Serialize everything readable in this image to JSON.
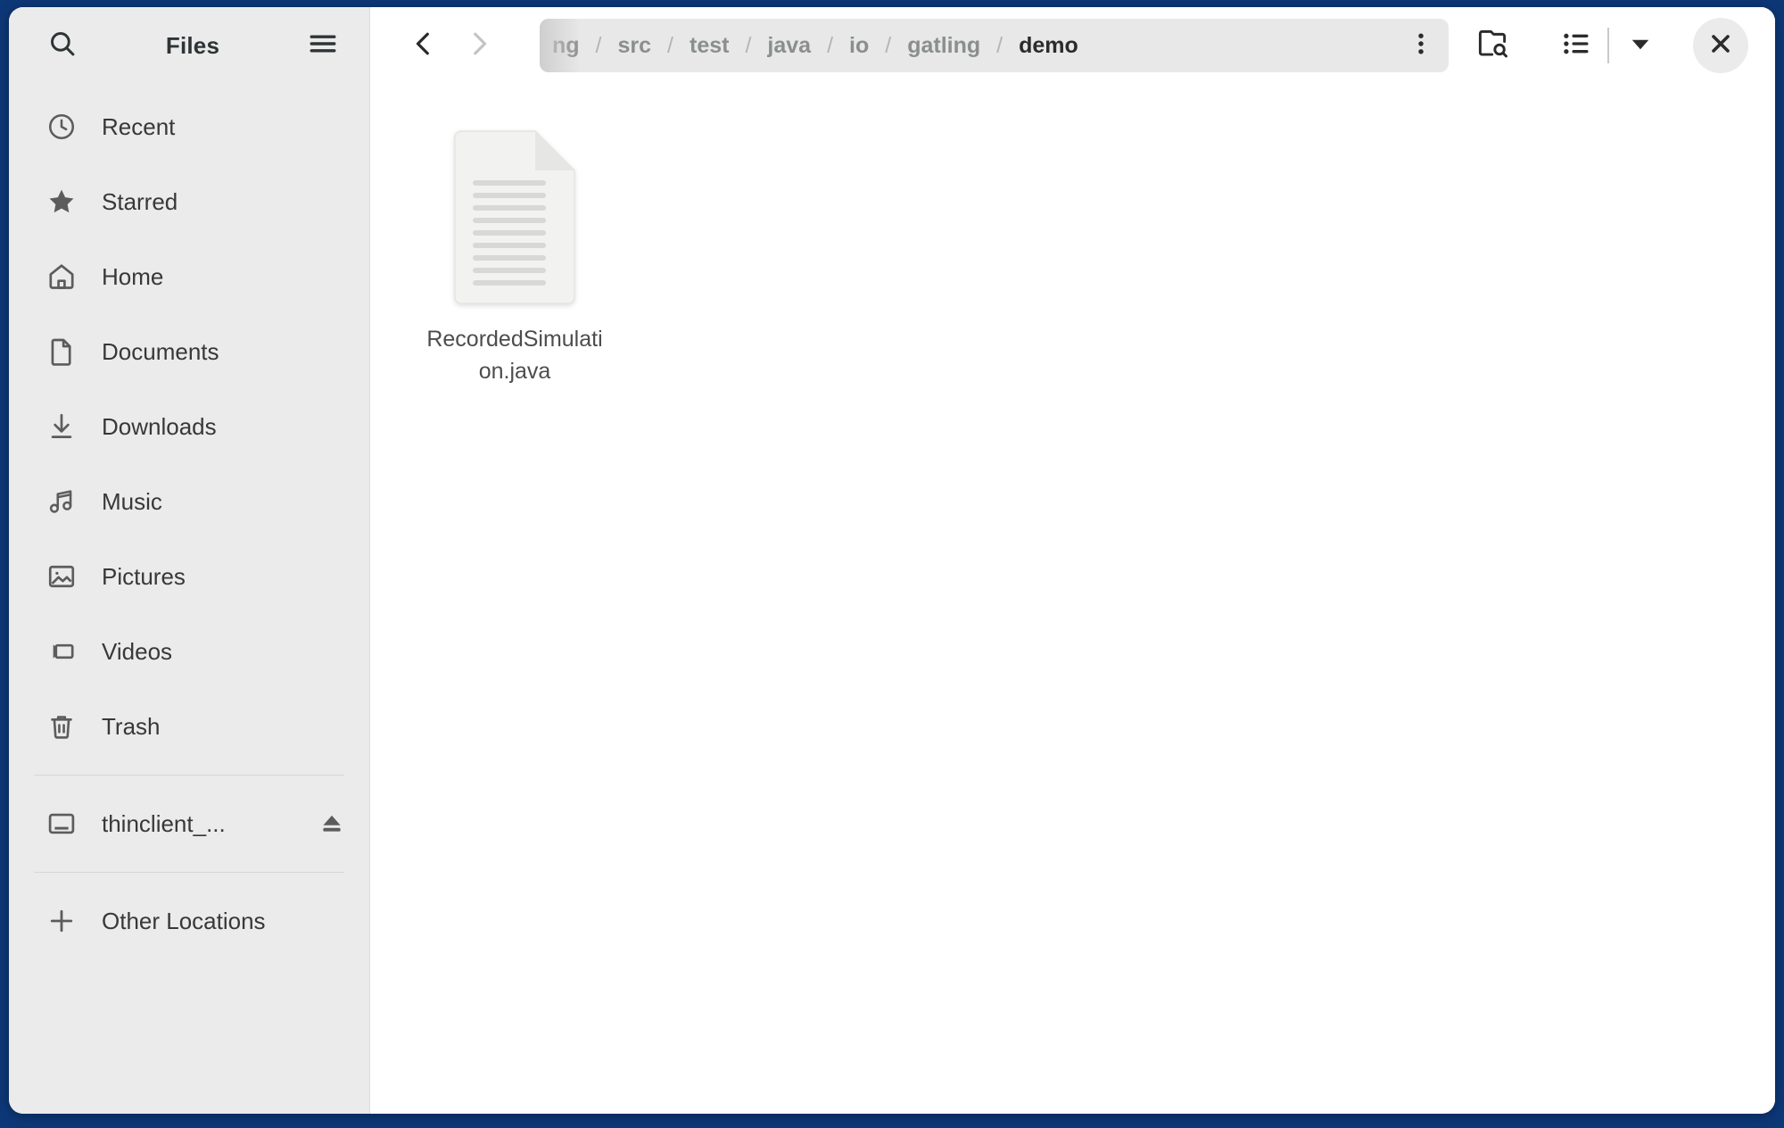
{
  "window": {
    "app_title": "Files",
    "accent_background": "#0d3878",
    "sidebar_background": "#ebebeb",
    "content_background": "#ffffff"
  },
  "sidebar": {
    "search_icon": "search-icon",
    "menu_icon": "hamburger-menu-icon",
    "items": [
      {
        "label": "Recent",
        "icon": "clock-icon"
      },
      {
        "label": "Starred",
        "icon": "star-icon"
      },
      {
        "label": "Home",
        "icon": "home-icon"
      },
      {
        "label": "Documents",
        "icon": "document-icon"
      },
      {
        "label": "Downloads",
        "icon": "download-arrow-icon"
      },
      {
        "label": "Music",
        "icon": "music-note-icon"
      },
      {
        "label": "Pictures",
        "icon": "picture-icon"
      },
      {
        "label": "Videos",
        "icon": "video-camera-icon"
      },
      {
        "label": "Trash",
        "icon": "trash-icon"
      }
    ],
    "devices": [
      {
        "label": "thinclient_...",
        "icon": "drive-icon",
        "eject_icon": "eject-icon"
      }
    ],
    "other_locations": {
      "label": "Other Locations",
      "icon": "plus-icon"
    }
  },
  "toolbar": {
    "back_icon": "chevron-left-icon",
    "forward_icon": "chevron-right-icon",
    "path_menu_icon": "vertical-dots-icon",
    "search_folder_icon": "folder-search-icon",
    "view_list_icon": "list-view-icon",
    "view_dropdown_icon": "chevron-down-icon",
    "close_icon": "close-icon"
  },
  "breadcrumb": {
    "separator": "/",
    "segments": [
      {
        "label": "ng",
        "current": false,
        "truncated": true
      },
      {
        "label": "src",
        "current": false,
        "truncated": false
      },
      {
        "label": "test",
        "current": false,
        "truncated": false
      },
      {
        "label": "java",
        "current": false,
        "truncated": false
      },
      {
        "label": "io",
        "current": false,
        "truncated": false
      },
      {
        "label": "gatling",
        "current": false,
        "truncated": false
      },
      {
        "label": "demo",
        "current": true,
        "truncated": false
      }
    ]
  },
  "files": [
    {
      "name": "RecordedSimulation.java",
      "icon": "text-file-icon"
    }
  ]
}
